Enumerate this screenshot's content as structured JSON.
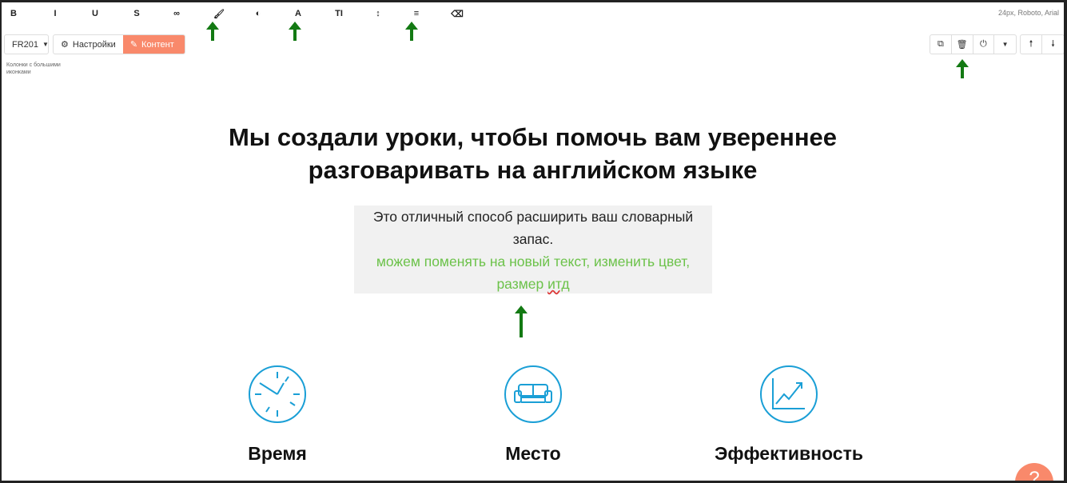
{
  "toolbar": {
    "tools": [
      {
        "icon": "bold-icon",
        "glyph": "B"
      },
      {
        "icon": "italic-icon",
        "glyph": "I"
      },
      {
        "icon": "underline-icon",
        "glyph": "U"
      },
      {
        "icon": "strikethrough-icon",
        "glyph": "S"
      },
      {
        "icon": "link-icon",
        "glyph": "∞"
      },
      {
        "icon": "brush-icon",
        "glyph": "🖌"
      },
      {
        "icon": "contrast-icon",
        "glyph": "◐"
      },
      {
        "icon": "font-color-icon",
        "glyph": "A"
      },
      {
        "icon": "font-size-icon",
        "glyph": "TI"
      },
      {
        "icon": "line-height-icon",
        "glyph": "↕"
      },
      {
        "icon": "align-icon",
        "glyph": "≡"
      },
      {
        "icon": "eraser-icon",
        "glyph": "⌫"
      }
    ],
    "font_info": "24px, Roboto, Arial"
  },
  "controls": {
    "block_select": "FR201",
    "settings": "Настройки",
    "content": "Контент",
    "block_label": "Колонки с большими иконками"
  },
  "block_actions": [
    "copy-icon",
    "trash-icon",
    "power-icon",
    "caret-down-icon",
    "arrow-up-icon",
    "arrow-down-icon"
  ],
  "main": {
    "heading_line1": "Мы создали уроки, чтобы помочь вам увереннее",
    "heading_line2": "разговаривать на английском языке",
    "text_line1": "Это отличный способ расширить ваш словарный",
    "text_line2": "запас.",
    "green_line1": "можем поменять на новый текст, изменить цвет,",
    "green_line2a": "размер ",
    "green_line2b": "итд",
    "columns": [
      {
        "icon": "clock-icon",
        "title": "Время"
      },
      {
        "icon": "sofa-icon",
        "title": "Место"
      },
      {
        "icon": "chart-icon",
        "title": "Эффективность"
      }
    ]
  },
  "colors": {
    "accent": "#f9896b",
    "icon": "#1a9fd6",
    "arrow": "#137a13",
    "green_text": "#6cc24a"
  }
}
